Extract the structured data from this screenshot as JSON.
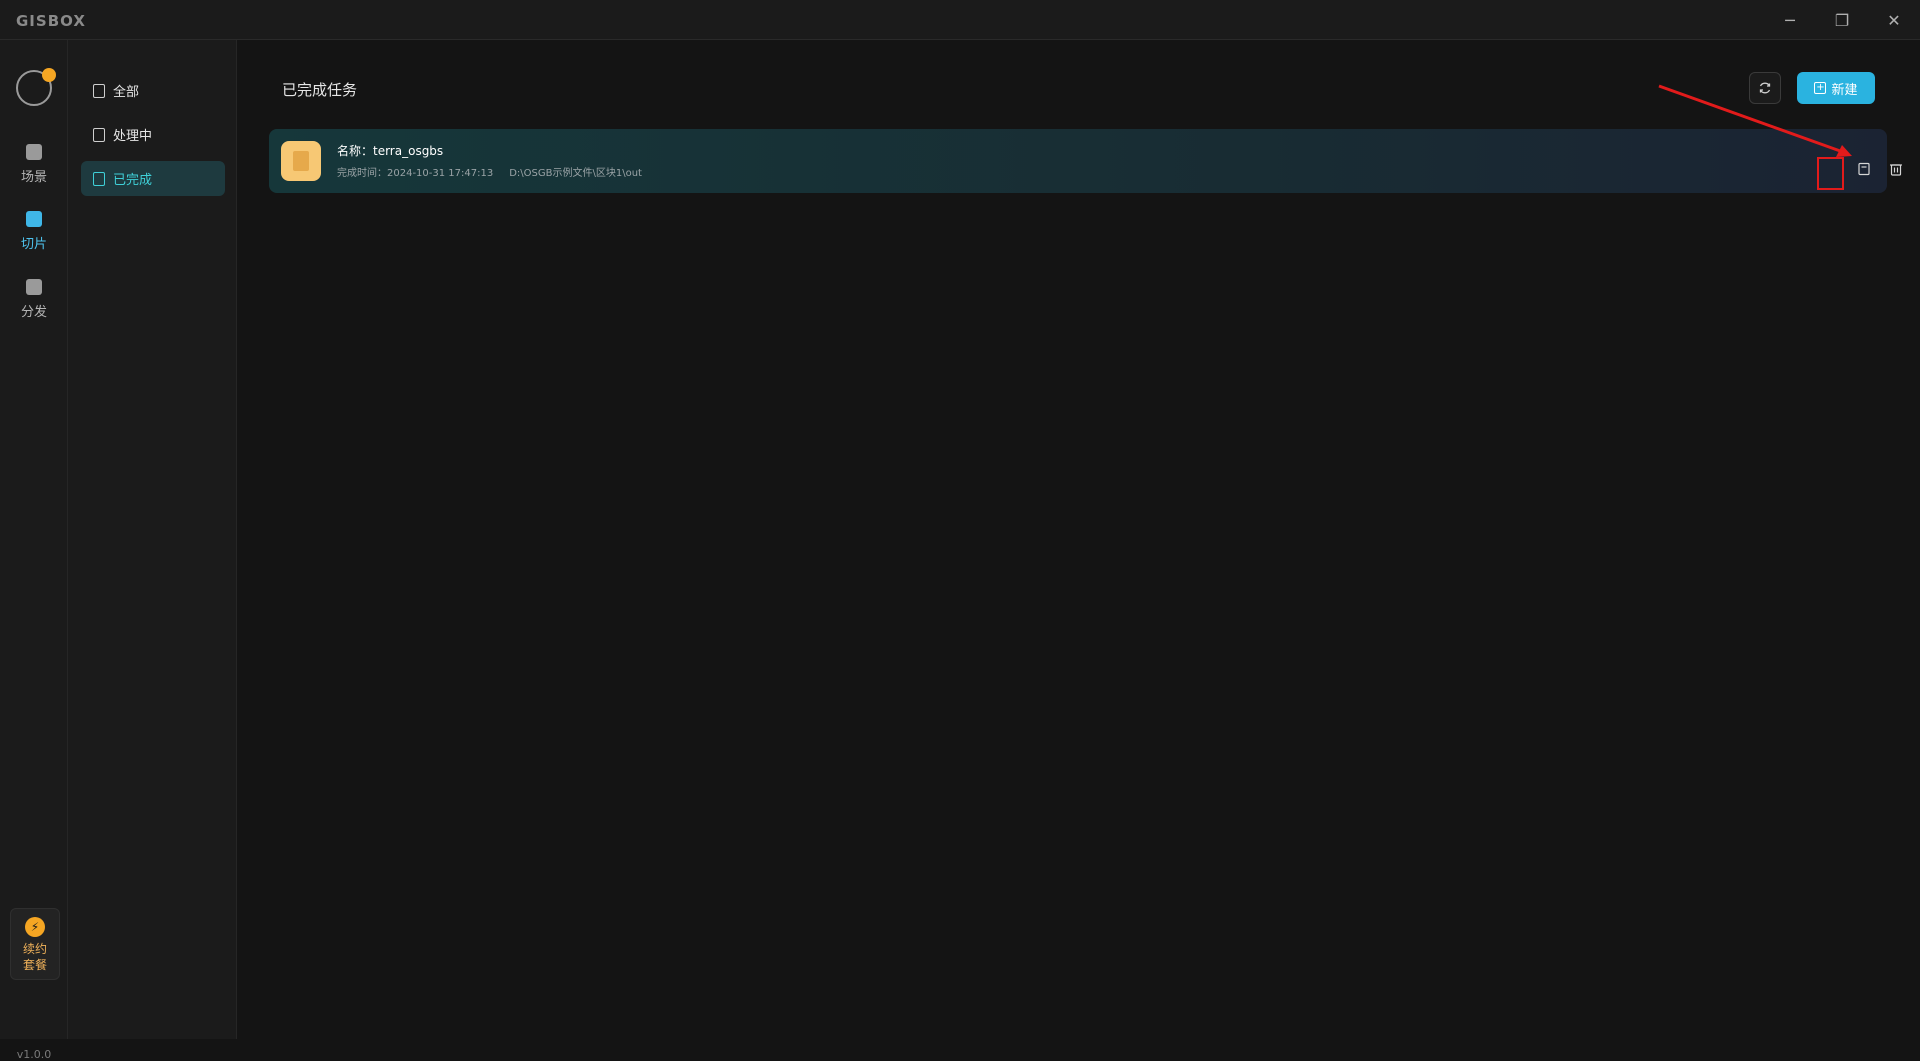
{
  "app": {
    "logo": "GISBOX"
  },
  "window_controls": {
    "minimize": "─",
    "restore": "❐",
    "close": "✕"
  },
  "rail": {
    "items": [
      {
        "label": "场景",
        "icon": "home-icon"
      },
      {
        "label": "切片",
        "icon": "slice-icon",
        "active": true
      },
      {
        "label": "分发",
        "icon": "distribute-icon"
      }
    ],
    "renew_label": "续约套餐",
    "version": "v1.0.0"
  },
  "sidebar": {
    "items": [
      {
        "label": "全部"
      },
      {
        "label": "处理中"
      },
      {
        "label": "已完成",
        "active": true
      }
    ]
  },
  "main": {
    "title": "已完成任务",
    "new_button": "新建",
    "task": {
      "name": "名称：terra_osgbs",
      "completed_time": "完成时间：2024-10-31 17:47:13",
      "path": "D:\\OSGB示例文件\\区块1\\out"
    }
  },
  "colors": {
    "accent": "#2ab3e0",
    "active_text": "#3fd0d8",
    "annotation": "#e21b1b",
    "thumb": "#f7c874"
  }
}
